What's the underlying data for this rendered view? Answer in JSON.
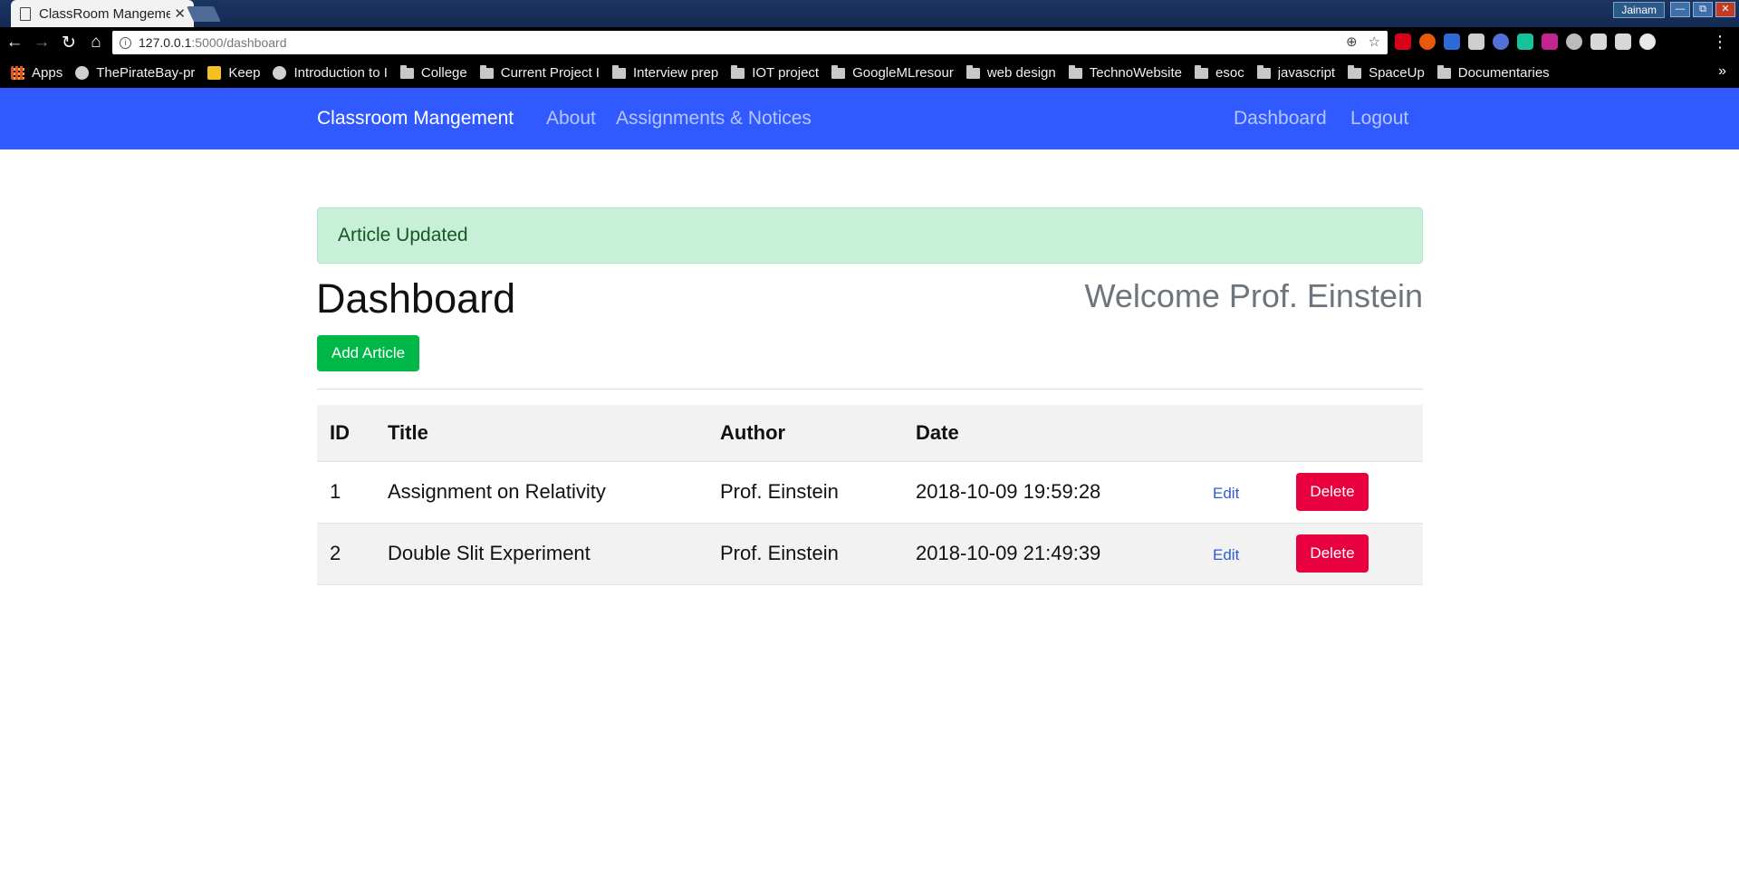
{
  "browser": {
    "tab_title": "ClassRoom Mangement",
    "tab_close": "✕",
    "user_badge": "Jainam",
    "window_buttons": [
      "—",
      "⧉",
      "✕"
    ],
    "url_host": "127.0.0.1",
    "url_rest": ":5000/dashboard",
    "bookmarks": [
      {
        "label": "Apps",
        "icon": "apps-grid-icon"
      },
      {
        "label": "ThePirateBay-pr",
        "icon": "site-icon"
      },
      {
        "label": "Keep",
        "icon": "keep-icon"
      },
      {
        "label": "Introduction to I",
        "icon": "site-icon"
      },
      {
        "label": "College",
        "icon": "folder-icon"
      },
      {
        "label": "Current Project I",
        "icon": "folder-icon"
      },
      {
        "label": "Interview prep",
        "icon": "folder-icon"
      },
      {
        "label": "IOT project",
        "icon": "folder-icon"
      },
      {
        "label": "GoogleMLresour",
        "icon": "folder-icon"
      },
      {
        "label": "web design",
        "icon": "folder-icon"
      },
      {
        "label": "TechnoWebsite",
        "icon": "folder-icon"
      },
      {
        "label": "esoc",
        "icon": "folder-icon"
      },
      {
        "label": "javascript",
        "icon": "folder-icon"
      },
      {
        "label": "SpaceUp",
        "icon": "folder-icon"
      },
      {
        "label": "Documentaries",
        "icon": "folder-icon"
      }
    ],
    "more_bookmarks": "»",
    "extension_colors": [
      "#d9001b",
      "#e8590c",
      "#2d6ad6",
      "#cfcfcf",
      "#5470d8",
      "#15c39a",
      "#c2258f",
      "#bbbbbb",
      "#d8d8d8",
      "#d8d8d8",
      "#e8e8e8"
    ]
  },
  "navbar": {
    "brand": "Classroom Mangement",
    "links": [
      "About",
      "Assignments & Notices"
    ],
    "right_links": [
      "Dashboard",
      "Logout"
    ]
  },
  "alert": {
    "message": "Article Updated"
  },
  "page": {
    "title": "Dashboard",
    "welcome": "Welcome Prof. Einstein",
    "add_button": "Add Article"
  },
  "table": {
    "headers": [
      "ID",
      "Title",
      "Author",
      "Date"
    ],
    "rows": [
      {
        "id": "1",
        "title": "Assignment on Relativity",
        "author": "Prof. Einstein",
        "date": "2018-10-09 19:59:28",
        "edit": "Edit",
        "delete": "Delete"
      },
      {
        "id": "2",
        "title": "Double Slit Experiment",
        "author": "Prof. Einstein",
        "date": "2018-10-09 21:49:39",
        "edit": "Edit",
        "delete": "Delete"
      }
    ]
  },
  "colors": {
    "navbar_bg": "#3059ff",
    "alert_bg": "#c8f0d8",
    "success": "#00b848",
    "danger": "#e8003f",
    "link": "#2b5bd6"
  }
}
